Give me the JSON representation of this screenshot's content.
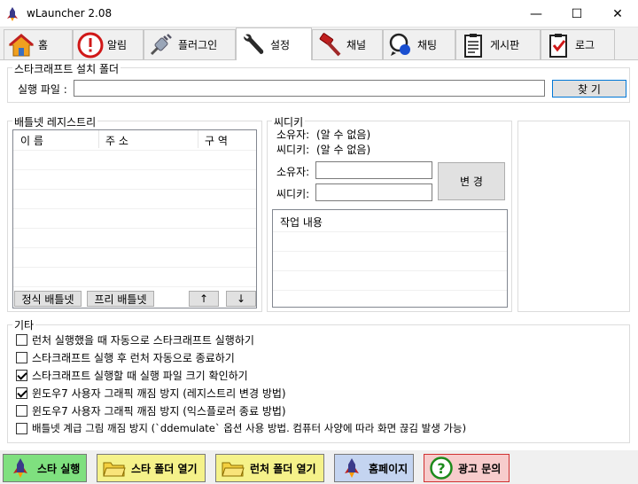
{
  "window": {
    "title": "wLauncher 2.08",
    "minimize": "—",
    "maximize": "☐",
    "close": "✕"
  },
  "tabs": [
    {
      "label": "홈",
      "icon": "home-icon"
    },
    {
      "label": "알림",
      "icon": "alert-icon"
    },
    {
      "label": "플러그인",
      "icon": "plug-icon"
    },
    {
      "label": "설정",
      "icon": "wrench-icon",
      "active": true
    },
    {
      "label": "채널",
      "icon": "hammer-icon"
    },
    {
      "label": "채팅",
      "icon": "chat-icon"
    },
    {
      "label": "게시판",
      "icon": "clipboard-icon"
    },
    {
      "label": "로그",
      "icon": "checklist-icon"
    }
  ],
  "install": {
    "legend": "스타크래프트 설치 폴더",
    "exe_label": "실행 파일 :",
    "exe_value": "",
    "find_button": "찾 기"
  },
  "registry": {
    "legend": "배틀넷 레지스트리",
    "columns": [
      "이 름",
      "주 소",
      "구 역"
    ],
    "rows": [],
    "official_button": "정식 배틀넷",
    "free_button": "프리 배틀넷",
    "up_button": "↑",
    "down_button": "↓"
  },
  "cdkey": {
    "legend": "씨디키",
    "owner_label": "소유자:",
    "owner_value": "(알 수 없음)",
    "key_label": "씨디키:",
    "key_value": "(알 수 없음)",
    "owner_input_label": "소유자:",
    "owner_input": "",
    "key_input_label": "씨디키:",
    "key_input": "",
    "change_button": "변 경",
    "log_header": "작업 내용"
  },
  "misc": {
    "legend": "기타",
    "options": [
      {
        "label": "런처 실행했을 때 자동으로 스타크래프트 실행하기",
        "checked": false
      },
      {
        "label": "스타크래프트 실행 후 런처 자동으로 종료하기",
        "checked": false
      },
      {
        "label": "스타크래프트 실행할 때 실행 파일 크기 확인하기",
        "checked": true
      },
      {
        "label": "윈도우7 사용자 그래픽 깨짐 방지 (레지스트리 변경 방법)",
        "checked": true
      },
      {
        "label": "윈도우7 사용자 그래픽 깨짐 방지 (익스플로러 종료 방법)",
        "checked": false
      },
      {
        "label": "배틀넷 계급 그림 깨짐 방지 (`ddemulate` 옵션 사용 방법. 컴퓨터 사양에 따라 화면 끊김 발생 가능)",
        "checked": false
      }
    ]
  },
  "bottom": [
    {
      "label": "스타 실행",
      "icon": "rocket-icon",
      "bg": "#7fe07f"
    },
    {
      "label": "스타 폴더 열기",
      "icon": "folder-icon",
      "bg": "#f5f28a"
    },
    {
      "label": "런처 폴더 열기",
      "icon": "folder-icon",
      "bg": "#f5f28a"
    },
    {
      "label": "홈페이지",
      "icon": "rocket-icon",
      "bg": "#c4d4f0"
    },
    {
      "label": "광고 문의",
      "icon": "question-icon",
      "bg": "#f7cccc"
    }
  ]
}
